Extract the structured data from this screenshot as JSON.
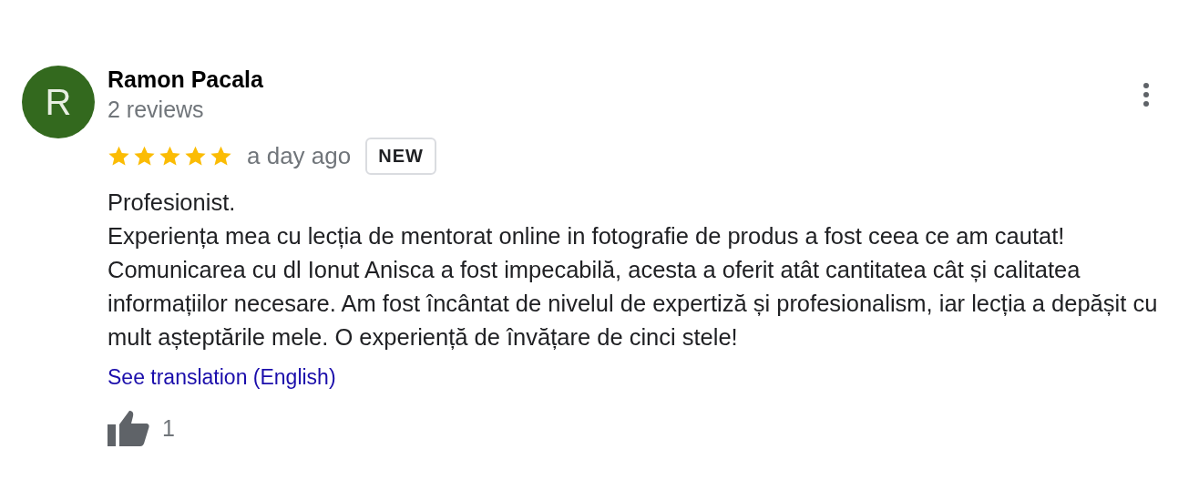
{
  "review": {
    "avatar_letter": "R",
    "name": "Ramon Pacala",
    "review_count": "2 reviews",
    "stars": 5,
    "time": "a day ago",
    "badge": "NEW",
    "text_lines": [
      "Profesionist.",
      "Experiența mea cu lecția de mentorat online in fotografie de produs a fost ceea ce am cautat!",
      "Comunicarea cu dl Ionut Anisca a fost impecabilă, acesta a oferit atât cantitatea cât și calitatea informațiilor necesare. Am fost încântat de nivelul de expertiză și profesionalism, iar lecția a depășit cu mult așteptările mele. O experiență de învățare de cinci stele!"
    ],
    "translation_link": "See translation (English)",
    "likes": "1"
  }
}
